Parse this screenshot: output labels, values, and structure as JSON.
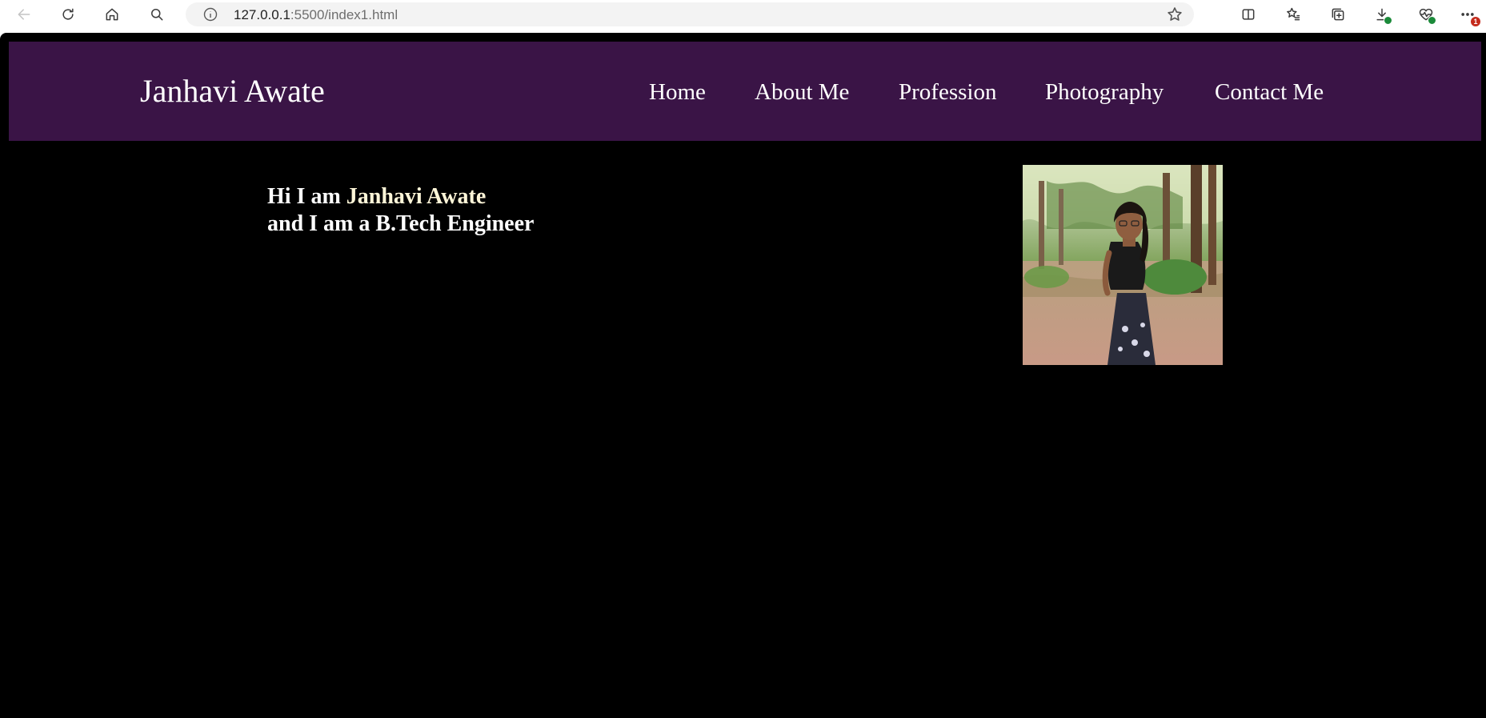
{
  "browser": {
    "url_host": "127.0.0.1",
    "url_rest": ":5500/index1.html",
    "icons": {
      "back": "back-arrow-icon",
      "refresh": "refresh-icon",
      "home": "home-icon",
      "search": "search-icon",
      "info": "info-icon",
      "favorite": "star-icon",
      "split_screen": "split-screen-icon",
      "favorites": "favorites-icon",
      "collections": "collections-icon",
      "downloads": "download-icon",
      "performance": "heart-pulse-icon",
      "more": "more-icon"
    },
    "more_badge": "1"
  },
  "site": {
    "brand": "Janhavi Awate",
    "nav": [
      {
        "label": "Home"
      },
      {
        "label": "About Me"
      },
      {
        "label": "Profession"
      },
      {
        "label": "Photography"
      },
      {
        "label": "Contact Me"
      }
    ],
    "hero": {
      "line1_prefix": "Hi I am ",
      "line1_name": "Janhavi Awate",
      "line2": "and I am a B.Tech Engineer"
    },
    "photo_alt": "profile-photo"
  },
  "colors": {
    "header_bg": "#3a1446",
    "page_bg": "#000000",
    "text": "#ffffff"
  }
}
